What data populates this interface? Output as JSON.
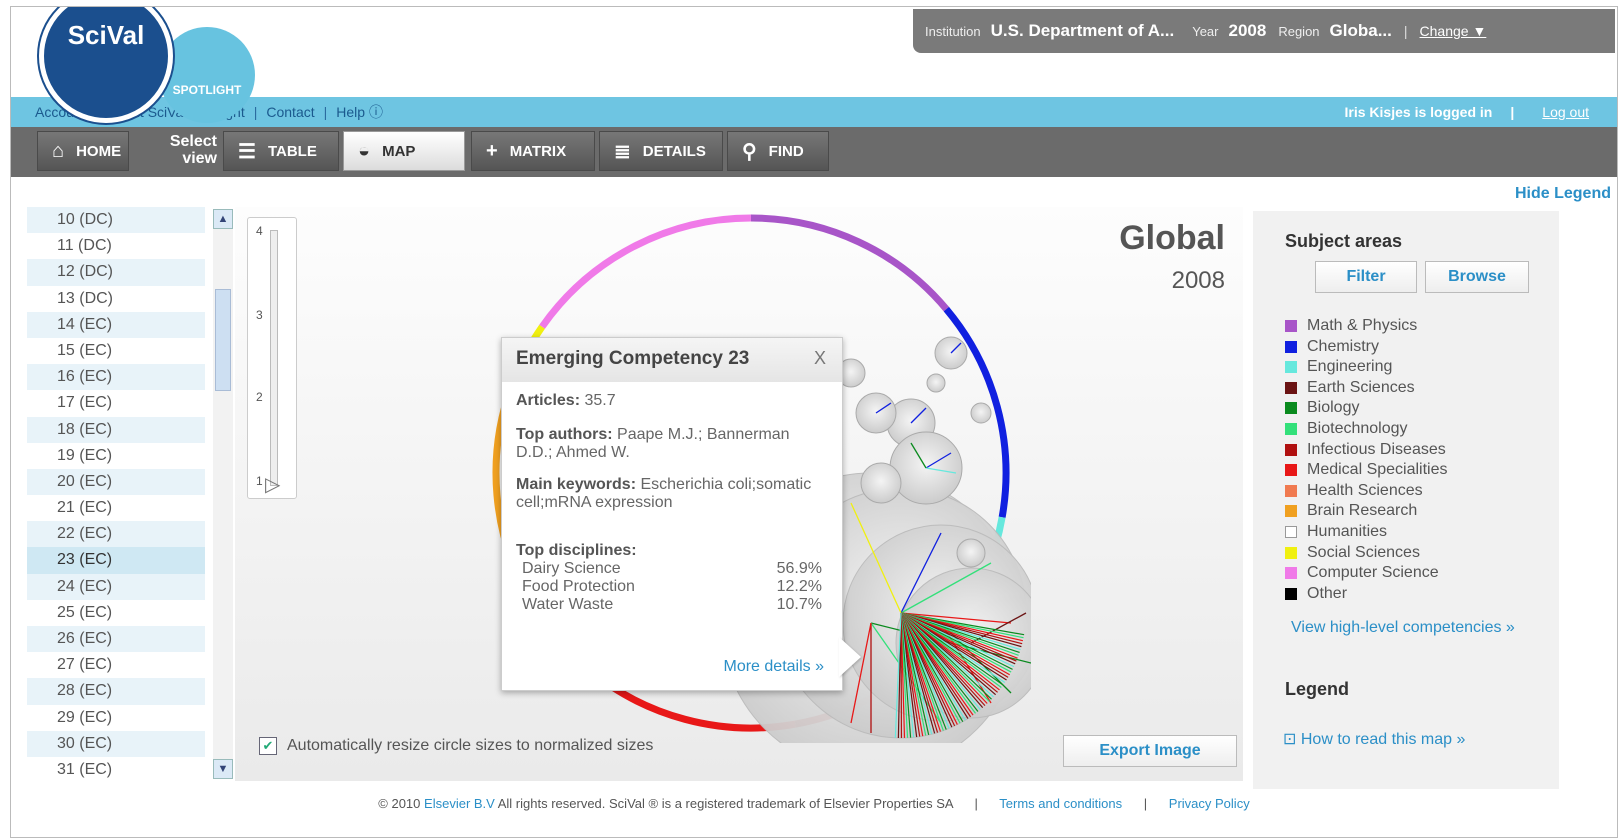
{
  "logo": {
    "main": "SciVal",
    "sub": "SPOTLIGHT"
  },
  "institution_bar": {
    "institution_label": "Institution",
    "institution_value": "U.S. Department of A...",
    "year_label": "Year",
    "year_value": "2008",
    "region_label": "Region",
    "region_value": "Globa...",
    "separator": "|",
    "change_label": "Change ▼"
  },
  "top_links": {
    "items": [
      "Account",
      "About SciVal Spotlight",
      "Contact",
      "Help ⓘ"
    ],
    "user_status": "Iris Kisjes is logged in",
    "logout": "Log out"
  },
  "nav": {
    "home": "HOME",
    "select_view_1": "Select",
    "select_view_2": "view",
    "table": "TABLE",
    "map": "MAP",
    "matrix": "MATRIX",
    "details": "DETAILS",
    "find": "FIND"
  },
  "hide_legend": "Hide Legend",
  "list": {
    "items": [
      "10 (DC)",
      "11 (DC)",
      "12 (DC)",
      "13 (DC)",
      "14 (EC)",
      "15 (EC)",
      "16 (EC)",
      "17 (EC)",
      "18 (EC)",
      "19 (EC)",
      "20 (EC)",
      "21 (EC)",
      "22 (EC)",
      "23 (EC)",
      "24 (EC)",
      "25 (EC)",
      "26 (EC)",
      "27 (EC)",
      "28 (EC)",
      "29 (EC)",
      "30 (EC)",
      "31 (EC)"
    ],
    "selected": "23 (EC)"
  },
  "slider": {
    "ticks": [
      "4",
      "3",
      "2",
      "1"
    ],
    "value": 1
  },
  "map_title": "Global",
  "map_year": "2008",
  "popup": {
    "title": "Emerging Competency 23",
    "close": "X",
    "articles_label": "Articles:",
    "articles_value": "35.7",
    "authors_label": "Top authors:",
    "authors_value": "Paape M.J.; Bannerman D.D.; Ahmed W.",
    "keywords_label": "Main keywords:",
    "keywords_value": "Escherichia coli;somatic cell;mRNA expression",
    "disciplines_label": "Top disciplines:",
    "disciplines": [
      {
        "name": "Dairy Science",
        "pct": "56.9%"
      },
      {
        "name": "Food Protection",
        "pct": "12.2%"
      },
      {
        "name": "Water Waste",
        "pct": "10.7%"
      }
    ],
    "more_details": "More details »"
  },
  "auto_resize": {
    "label": "Automatically resize circle sizes to normalized sizes",
    "checked": true
  },
  "export_button": "Export Image",
  "panel": {
    "subject_title": "Subject areas",
    "filter": "Filter",
    "browse": "Browse",
    "subjects": [
      {
        "name": "Math & Physics",
        "color": "#a855c8"
      },
      {
        "name": "Chemistry",
        "color": "#1020e0"
      },
      {
        "name": "Engineering",
        "color": "#66e8dd"
      },
      {
        "name": "Earth Sciences",
        "color": "#6b1414"
      },
      {
        "name": "Biology",
        "color": "#0a8a1e"
      },
      {
        "name": "Biotechnology",
        "color": "#33e07a"
      },
      {
        "name": "Infectious Diseases",
        "color": "#b01010"
      },
      {
        "name": "Medical Specialities",
        "color": "#e81818"
      },
      {
        "name": "Health Sciences",
        "color": "#f07a50"
      },
      {
        "name": "Brain Research",
        "color": "#f0a020"
      },
      {
        "name": "Humanities",
        "color": "#ffffff"
      },
      {
        "name": "Social Sciences",
        "color": "#f0f010"
      },
      {
        "name": "Computer Science",
        "color": "#f07ae8"
      },
      {
        "name": "Other",
        "color": "#000000"
      }
    ],
    "high_level_link": "View high-level competencies »",
    "legend_title": "Legend",
    "how_to_read": "How to read this map »"
  },
  "footer": {
    "copyright_prefix": "© 2010",
    "elsevier": "Elsevier B.V",
    "copyright_rest": "All rights reserved. SciVal ® is a registered trademark of Elsevier Properties SA",
    "terms": "Terms and conditions",
    "privacy": "Privacy Policy"
  }
}
